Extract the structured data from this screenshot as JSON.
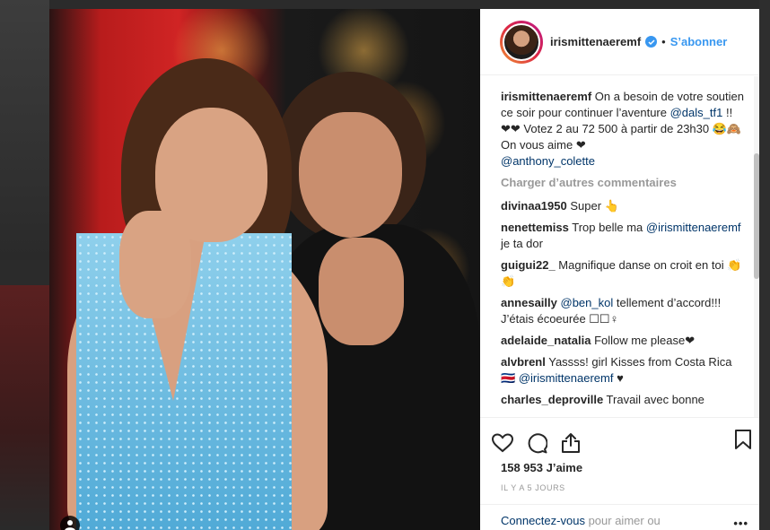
{
  "post": {
    "username": "irismittenaeremf",
    "follow_label": "S’abonner",
    "separator": "•",
    "caption": {
      "username": "irismittenaeremf",
      "text_1": " On a besoin de votre soutien ce soir pour continuer l’aventure ",
      "mention_1": "@dals_tf1",
      "text_2": " !! ❤❤ Votez 2 au 72 500 à partir de 23h30 😂🙈",
      "text_3": "On vous aime ❤",
      "mention_2": "@anthony_colette"
    },
    "load_more": "Charger d’autres commentaires",
    "comments": [
      {
        "user": "divinaa1950",
        "text": " Super 👆"
      },
      {
        "user": "nenettemiss",
        "text_a": " Trop belle ma ",
        "mention": "@irismittenaeremf",
        "text_b": " je ta dor"
      },
      {
        "user": "guigui22_",
        "text": " Magnifique danse on croit en toi 👏👏"
      },
      {
        "user": "annesailly",
        "mention": "@ben_kol",
        "text_b": " tellement d’accord!!! J’étais écoeurée ☐☐♀"
      },
      {
        "user": "adelaide_natalia",
        "text": " Follow me please❤"
      },
      {
        "user": "alvbrenl",
        "text_a": " Yassss! girl Kisses from Costa Rica 🇨🇷 ",
        "mention": "@irismittenaeremf",
        "text_b": " ♥"
      },
      {
        "user": "charles_deproville",
        "text": " Travail avec bonne"
      }
    ],
    "likes": "158 953 J’aime",
    "time": "Il y a 5 jours",
    "login_link": "Connectez-vous",
    "login_text": " pour aimer ou commenter.",
    "more": "•••"
  },
  "icons": {
    "like": "heart-icon",
    "comment": "comment-icon",
    "share": "share-icon",
    "save": "bookmark-icon",
    "verified": "verified-badge-icon",
    "tag": "user-tag-icon"
  },
  "colors": {
    "accent": "#3897f0",
    "mention": "#003569",
    "muted": "#999999"
  }
}
